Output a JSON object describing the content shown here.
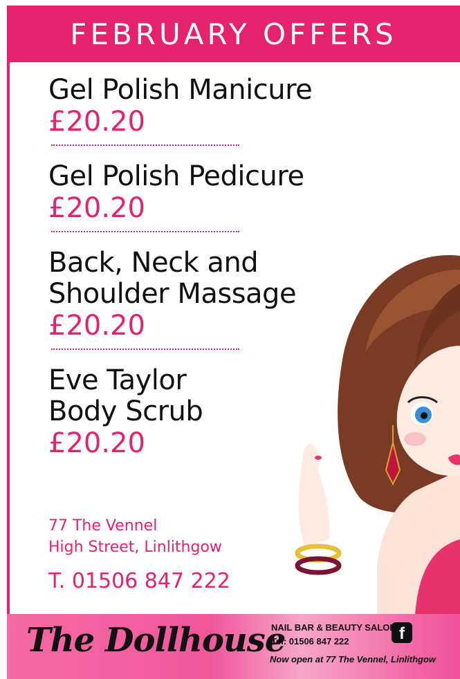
{
  "header": {
    "title": "FEBRUARY OFFERS"
  },
  "offers": [
    {
      "name_lines": [
        "Gel Polish Manicure"
      ],
      "price": "£20.20"
    },
    {
      "name_lines": [
        "Gel Polish Pedicure"
      ],
      "price": "£20.20"
    },
    {
      "name_lines": [
        "Back, Neck and",
        "Shoulder Massage"
      ],
      "price": "£20.20"
    },
    {
      "name_lines": [
        "Eve Taylor",
        "Body Scrub"
      ],
      "price": "£20.20"
    }
  ],
  "contact": {
    "address_line1": "77 The Vennel",
    "address_line2": "High Street, Linlithgow",
    "phone": "T. 01506 847 222"
  },
  "footer": {
    "brand": "The Dollhouse",
    "tagline": "NAIL BAR  &  BEAUTY SALON",
    "tel": "Tel: 01506 847 222",
    "notice": "Now open at 77 The Vennel, Linlithgow",
    "social_icon": "facebook-icon"
  },
  "colors": {
    "accent": "#e6226f",
    "text": "#111111",
    "background": "#ffffff"
  }
}
